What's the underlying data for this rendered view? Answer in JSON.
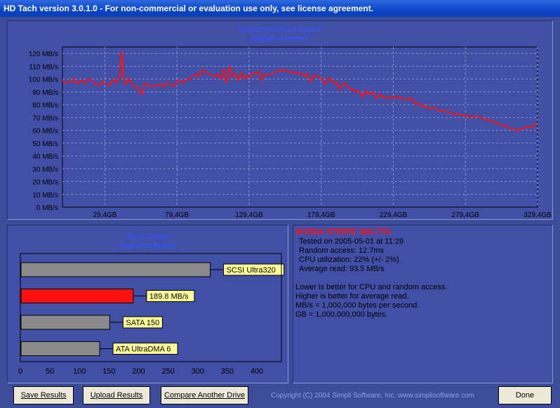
{
  "window": {
    "title": "HD Tach version 3.0.1.0  - For non-commercial or evaluation use only, see license agreement."
  },
  "colors": {
    "background": "#3c4c98",
    "panel": "#4150a6",
    "plot_area": "#4150a6",
    "series": "#ff1010",
    "bar_gray": "#8a8a8a",
    "bar_highlight": "#ff1010",
    "label_bg": "#ffff99"
  },
  "seq_chart": {
    "title_line1": "Sequential Read Speed",
    "title_line2": "(higher is better)",
    "chart_data": {
      "type": "line",
      "title": "Sequential Read Speed",
      "subtitle": "(higher is better)",
      "ylabel_unit": "MB/s",
      "y_ticks": [
        "120 MB/s",
        "110 MB/s",
        "100 MB/s",
        "90 MB/s",
        "80 MB/s",
        "70 MB/s",
        "60 MB/s",
        "50 MB/s",
        "40 MB/s",
        "30 MB/s",
        "20 MB/s",
        "10 MB/s",
        "0 MB/s"
      ],
      "x_ticks": [
        "29,4GB",
        "79,4GB",
        "129,4GB",
        "179,4GB",
        "229,4GB",
        "279,4GB",
        "329,4GB"
      ],
      "ylim": [
        0,
        125
      ],
      "xlim": [
        0,
        329.4
      ],
      "grid": true,
      "series": [
        {
          "x": [
            0,
            2,
            5,
            8,
            10,
            13,
            15,
            18,
            20,
            23,
            25,
            28,
            30,
            33,
            35,
            38,
            40,
            41,
            42,
            43,
            44,
            46,
            48,
            50,
            52,
            55,
            57,
            60,
            62,
            65,
            68,
            70,
            72,
            75,
            78,
            80,
            83,
            85,
            88,
            90,
            93,
            95,
            97,
            100,
            103,
            105,
            108,
            110,
            112,
            114,
            116,
            118,
            120,
            122,
            124,
            126,
            128,
            130,
            132,
            134,
            136,
            138,
            140,
            142,
            145,
            148,
            150,
            152,
            154,
            156,
            158,
            160,
            162,
            165,
            168,
            170,
            172,
            175,
            178,
            180,
            182,
            185,
            188,
            190,
            192,
            195,
            198,
            200,
            202,
            205,
            208,
            210,
            212,
            215,
            218,
            220,
            222,
            225,
            228,
            230,
            232,
            235,
            238,
            240,
            242,
            245,
            248,
            250,
            252,
            255,
            258,
            260,
            262,
            265,
            268,
            270,
            272,
            275,
            278,
            280,
            282,
            285,
            288,
            290,
            292,
            295,
            298,
            300,
            302,
            305,
            308,
            310,
            312,
            315,
            318,
            320,
            322,
            325,
            327,
            329
          ],
          "y": [
            99,
            97,
            98,
            100,
            96,
            99,
            97,
            100,
            99,
            96,
            95,
            98,
            96,
            95,
            100,
            97,
            103,
            122,
            105,
            98,
            96,
            100,
            97,
            94,
            93,
            88,
            97,
            95,
            94,
            95,
            96,
            94,
            97,
            96,
            95,
            99,
            97,
            99,
            100,
            102,
            104,
            102,
            107,
            105,
            103,
            102,
            104,
            100,
            108,
            97,
            110,
            102,
            104,
            99,
            105,
            100,
            103,
            101,
            105,
            104,
            106,
            99,
            104,
            103,
            104,
            105,
            107,
            106,
            107,
            106,
            105,
            106,
            104,
            105,
            102,
            104,
            98,
            103,
            102,
            100,
            96,
            101,
            97,
            98,
            92,
            97,
            94,
            93,
            90,
            91,
            86,
            91,
            88,
            90,
            85,
            88,
            86,
            85,
            86,
            85,
            86,
            85,
            85,
            84,
            85,
            80,
            81,
            78,
            79,
            77,
            78,
            76,
            75,
            75,
            74,
            73,
            72,
            73,
            71,
            72,
            70,
            71,
            71,
            70,
            69,
            68,
            67,
            66,
            65,
            64,
            63,
            62,
            61,
            60,
            61,
            62,
            63,
            62,
            64,
            66
          ],
          "unit_x": "GB",
          "unit_y": "MB/s"
        }
      ]
    }
  },
  "burst_chart": {
    "title_line1": "Burst Speed",
    "title_line2": "(higher is better)",
    "chart_data": {
      "type": "bar",
      "orientation": "horizontal",
      "title": "Burst Speed",
      "subtitle": "(higher is better)",
      "xlim": [
        0,
        400
      ],
      "x_ticks": [
        "0",
        "50",
        "100",
        "150",
        "200",
        "250",
        "300",
        "350",
        "400"
      ],
      "bars": [
        {
          "label": "SCSI Ultra320",
          "value": 320,
          "highlight": false
        },
        {
          "label": "189.8 MB/s",
          "value": 189.8,
          "highlight": true
        },
        {
          "label": "SATA 150",
          "value": 150,
          "highlight": false
        },
        {
          "label": "ATA UltraDMA 6",
          "value": 133,
          "highlight": false
        }
      ]
    }
  },
  "info": {
    "title": "NVIDIA STRIPE 306.77G",
    "tested": "Tested on 2005-05-01 at 11:29",
    "random_access": "Random access: 12.7ms",
    "cpu": "CPU utilization: 22% (+/- 2%)",
    "average_read": "Average read: 93.5 MB/s",
    "note1": "Lower is better for CPU and random access.",
    "note2": "Higher is better for average read.",
    "note3": "MB/s = 1,000,000 bytes per second.",
    "note4": "GB = 1,000,000,000 bytes."
  },
  "buttons": {
    "save": "Save Results",
    "upload": "Upload Results",
    "compare": "Compare Another Drive",
    "done": "Done"
  },
  "copyright": "Copyright (C) 2004 Simpli Software, Inc. www.simplisoftware.com"
}
